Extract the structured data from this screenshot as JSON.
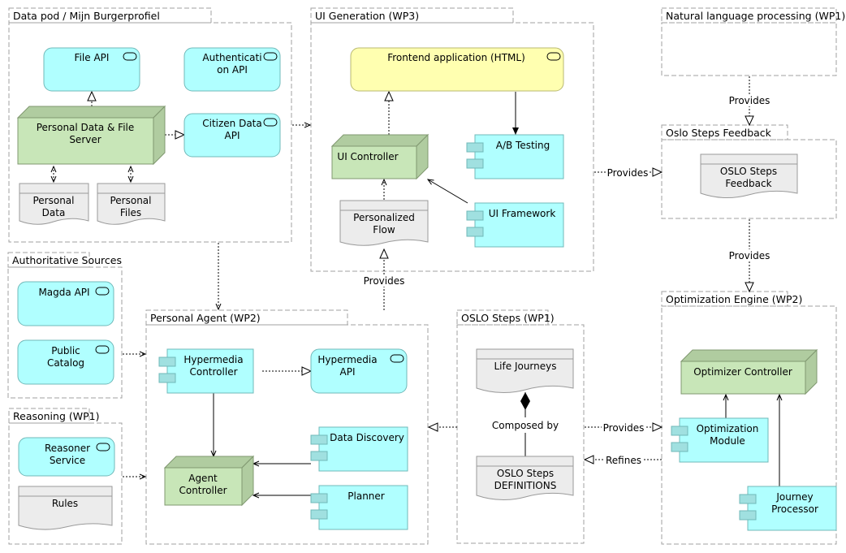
{
  "diagram": {
    "groups": {
      "data_pod": "Data pod / Mijn Burgerprofiel",
      "ui_generation": "UI Generation (WP3)",
      "nlp": "Natural language processing (WP1)",
      "oslo_feedback": "Oslo Steps Feedback",
      "authoritative": "Authoritative Sources",
      "reasoning": "Reasoning (WP1)",
      "personal_agent": "Personal Agent (WP2)",
      "oslo_steps": "OSLO Steps (WP1)",
      "optimization": "Optimization Engine (WP2)"
    },
    "elements": {
      "file_api": "File API",
      "auth_api_1": "Authenticati",
      "auth_api_2": "on API",
      "pdfs_1": "Personal Data & File",
      "pdfs_2": "Server",
      "citizen_api_1": "Citizen Data",
      "citizen_api_2": "API",
      "personal_data_1": "Personal",
      "personal_data_2": "Data",
      "personal_files_1": "Personal",
      "personal_files_2": "Files",
      "frontend": "Frontend application (HTML)",
      "ui_controller": "UI Controller",
      "ab_testing": "A/B Testing",
      "personalized_flow_1": "Personalized",
      "personalized_flow_2": "Flow",
      "ui_framework": "UI Framework",
      "oslo_feedback_doc_1": "OSLO Steps",
      "oslo_feedback_doc_2": "Feedback",
      "magda_api": "Magda API",
      "public_catalog_1": "Public",
      "public_catalog_2": "Catalog",
      "reasoner_1": "Reasoner",
      "reasoner_2": "Service",
      "rules": "Rules",
      "hyper_ctrl_1": "Hypermedia",
      "hyper_ctrl_2": "Controller",
      "hyper_api_1": "Hypermedia",
      "hyper_api_2": "API",
      "agent_ctrl_1": "Agent",
      "agent_ctrl_2": "Controller",
      "data_discovery": "Data Discovery",
      "planner": "Planner",
      "life_journeys": "Life Journeys",
      "oslo_defs_1": "OSLO Steps",
      "oslo_defs_2": "DEFINITIONS",
      "optimizer_ctrl": "Optimizer Controller",
      "opt_module_1": "Optimization",
      "opt_module_2": "Module",
      "journey_proc_1": "Journey",
      "journey_proc_2": "Processor"
    },
    "connection_labels": {
      "nlp_to_feedback": "Provides",
      "feedback_to_opt": "Provides",
      "ui_to_feedback": "Provides",
      "agent_to_ui": "Provides",
      "composed_by": "Composed by",
      "oslo_to_opt": "Provides",
      "opt_refines_oslo": "Refines"
    },
    "colors": {
      "service": "#b0ffff",
      "node": "#c8e6b8",
      "document": "#ececec",
      "frontend": "#ffffb0"
    }
  }
}
